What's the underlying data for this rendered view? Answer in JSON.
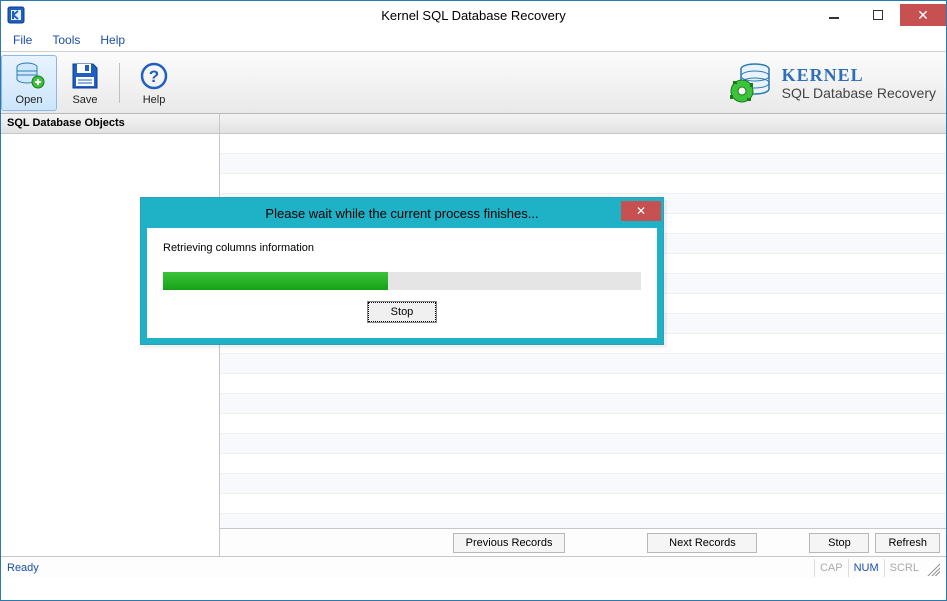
{
  "window": {
    "title": "Kernel SQL Database Recovery"
  },
  "menu": {
    "file": "File",
    "tools": "Tools",
    "help": "Help"
  },
  "toolbar": {
    "open": "Open",
    "save": "Save",
    "help": "Help"
  },
  "brand": {
    "title": "KERNEL",
    "subtitle": "SQL Database Recovery"
  },
  "sidebar": {
    "header": "SQL Database Objects"
  },
  "buttons": {
    "previous_records": "Previous Records",
    "next_records": "Next Records",
    "stop": "Stop",
    "refresh": "Refresh"
  },
  "status": {
    "left": "Ready",
    "cap": "CAP",
    "num": "NUM",
    "scrl": "SCRL"
  },
  "dialog": {
    "title": "Please wait while the current process finishes...",
    "message": "Retrieving columns information",
    "stop": "Stop",
    "progress_percent": 47
  }
}
